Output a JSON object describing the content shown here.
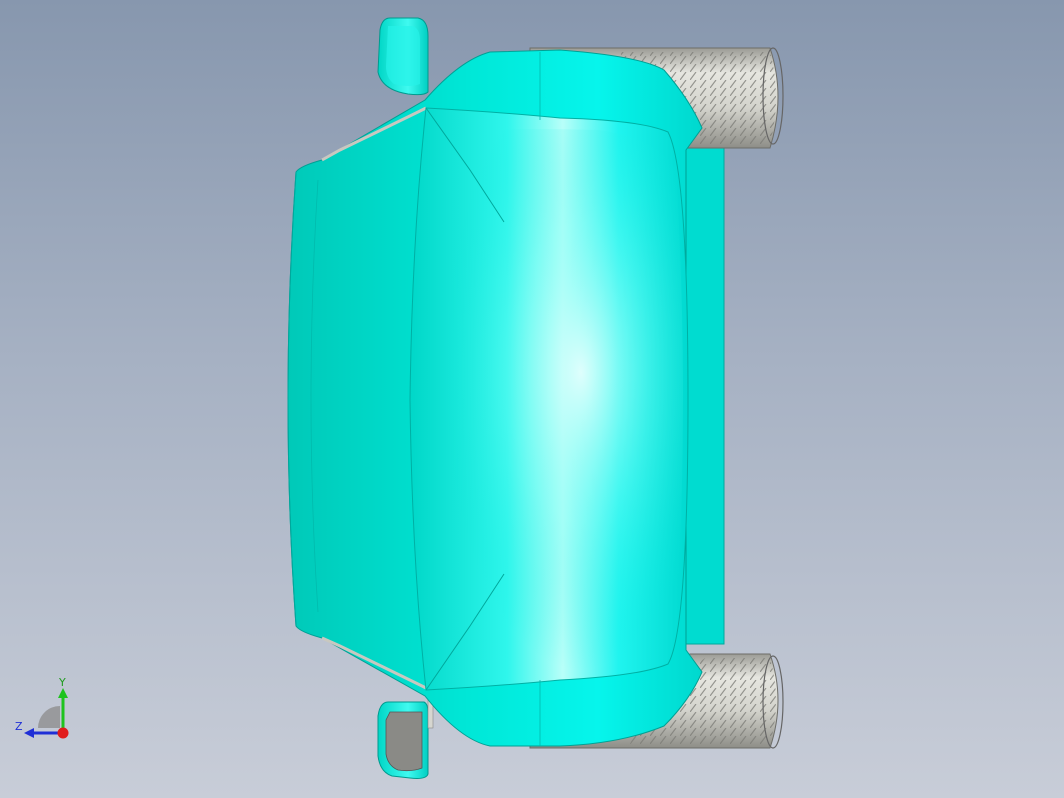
{
  "viewport": {
    "background_top": "#8797ae",
    "background_bottom": "#c8cdd8",
    "model": {
      "body_color": "#00e5d4",
      "highlight_color": "#bffff8",
      "tire_color": "#c9c9c2",
      "mirror_glass_color": "#8a8a86"
    }
  },
  "triad": {
    "y_label": "Y",
    "z_label": "Z",
    "y_color": "#1ec31e",
    "z_color": "#1f2fd6",
    "x_color": "#e01b1b"
  }
}
